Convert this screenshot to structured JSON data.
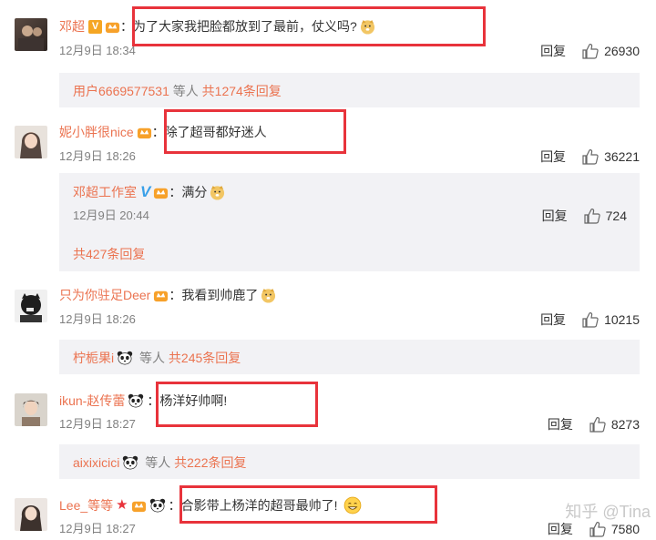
{
  "watermark": "知乎 @Tina",
  "reply_label": "回复",
  "comments": [
    {
      "username": "邓超",
      "text": "为了大家我把脸都放到了最前，仗义吗?",
      "time": "12月9日 18:34",
      "likes": "26930",
      "more": {
        "user": "用户6669577531",
        "suffix": " 等人 ",
        "count": "共1274条回复"
      }
    },
    {
      "username": "妮小胖很nice",
      "text": "除了超哥都好迷人",
      "time": "12月9日 18:26",
      "likes": "36221",
      "sub": {
        "username": "邓超工作室",
        "text": "：满分",
        "time": "12月9日 20:44",
        "likes": "724",
        "count": "共427条回复"
      }
    },
    {
      "username": "只为你驻足Deer",
      "text": "：我看到帅鹿了",
      "time": "12月9日 18:26",
      "likes": "10215",
      "more": {
        "user": "柠栀果i",
        "suffix": " 等人 ",
        "count": "共245条回复"
      }
    },
    {
      "username": "ikun-赵传蕾",
      "text": "：杨洋好帅啊!",
      "time": "12月9日 18:27",
      "likes": "8273",
      "more": {
        "user": "aixixicici",
        "suffix": " 等人 ",
        "count": "共222条回复"
      }
    },
    {
      "username": "Lee_等等",
      "text": "：合影带上杨洋的超哥最帅了!",
      "time": "12月9日 18:27",
      "likes": "7580"
    }
  ],
  "colors": {
    "username": "#eb7350",
    "highlight_box": "#e8333b",
    "sub_background": "#f2f2f5",
    "meta_gray": "#808080"
  }
}
